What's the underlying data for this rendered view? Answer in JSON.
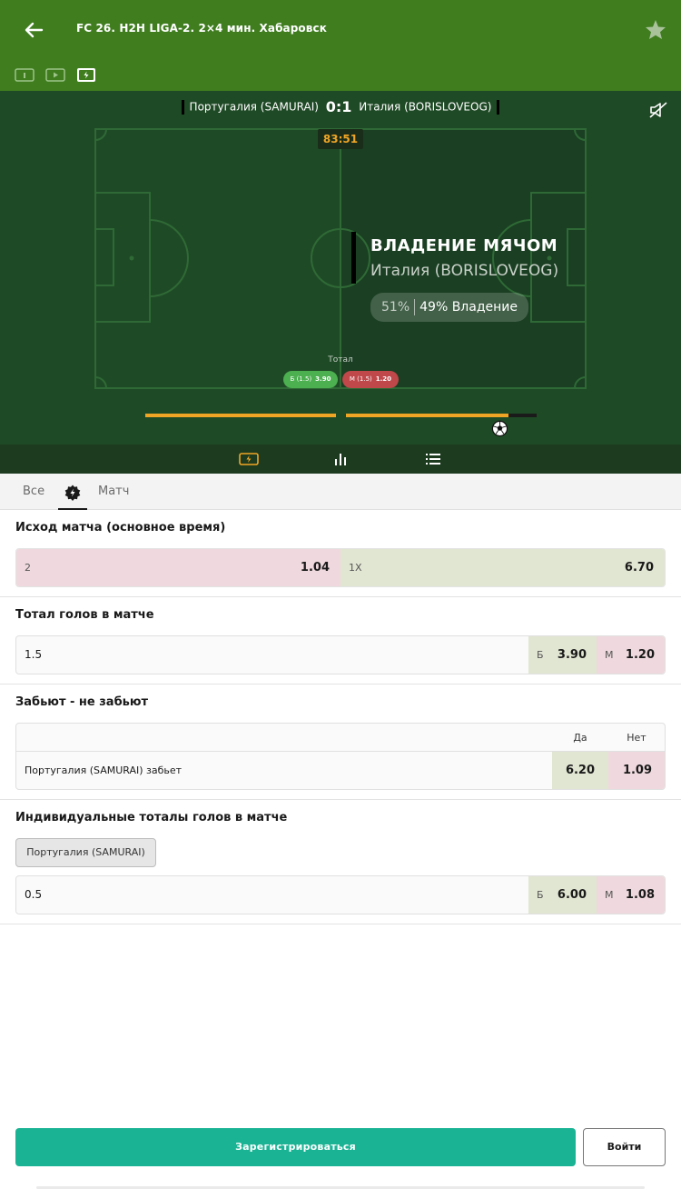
{
  "header": {
    "title": "FC 26. H2H LIGA-2. 2×4 мин. Хабаровск",
    "icons": [
      "back-arrow-icon",
      "star-icon",
      "scoreboard-icon",
      "video-icon",
      "field-view-icon"
    ]
  },
  "match": {
    "home_team": "Португалия (SAMURAI)",
    "score": "0:1",
    "away_team": "Италия (BORISLOVEOG)",
    "timer": "83:51"
  },
  "event": {
    "title": "ВЛАДЕНИЕ МЯЧОМ",
    "team": "Италия (BORISLOVEOG)",
    "home_pct": "51%",
    "away_text": "49% Владение"
  },
  "total_widget": {
    "label": "Тотал",
    "over_label": "Б (1.5)",
    "over_value": "3.90",
    "under_label": "М (1.5)",
    "under_value": "1.20"
  },
  "progress": {
    "first_half": 1.0,
    "second_half": 0.85
  },
  "filter_tabs": {
    "all": "Все",
    "match": "Матч"
  },
  "markets": {
    "outcome": {
      "title": "Исход матча (основное время)",
      "left_label": "2",
      "left_value": "1.04",
      "right_label": "1X",
      "right_value": "6.70"
    },
    "total": {
      "title": "Тотал голов в матче",
      "line": "1.5",
      "over_label": "Б",
      "over_value": "3.90",
      "under_label": "М",
      "under_value": "1.20"
    },
    "btts": {
      "title": "Забьют - не забьют",
      "col_yes": "Да",
      "col_no": "Нет",
      "row_label": "Португалия (SAMURAI) забьет",
      "yes_value": "6.20",
      "no_value": "1.09"
    },
    "individual": {
      "title": "Индивидуальные тоталы голов в матче",
      "chip": "Португалия (SAMURAI)",
      "line": "0.5",
      "over_label": "Б",
      "over_value": "6.00",
      "under_label": "М",
      "under_value": "1.08"
    }
  },
  "actions": {
    "register": "Зарегистрироваться",
    "login": "Войти"
  },
  "colors": {
    "header_green": "#3f7d1f",
    "pitch_dark": "#1f4a26",
    "accent_orange": "#f0a525",
    "register_teal": "#1ab394",
    "odds_pink": "#efd9de",
    "odds_olive": "#e1e6d2"
  }
}
